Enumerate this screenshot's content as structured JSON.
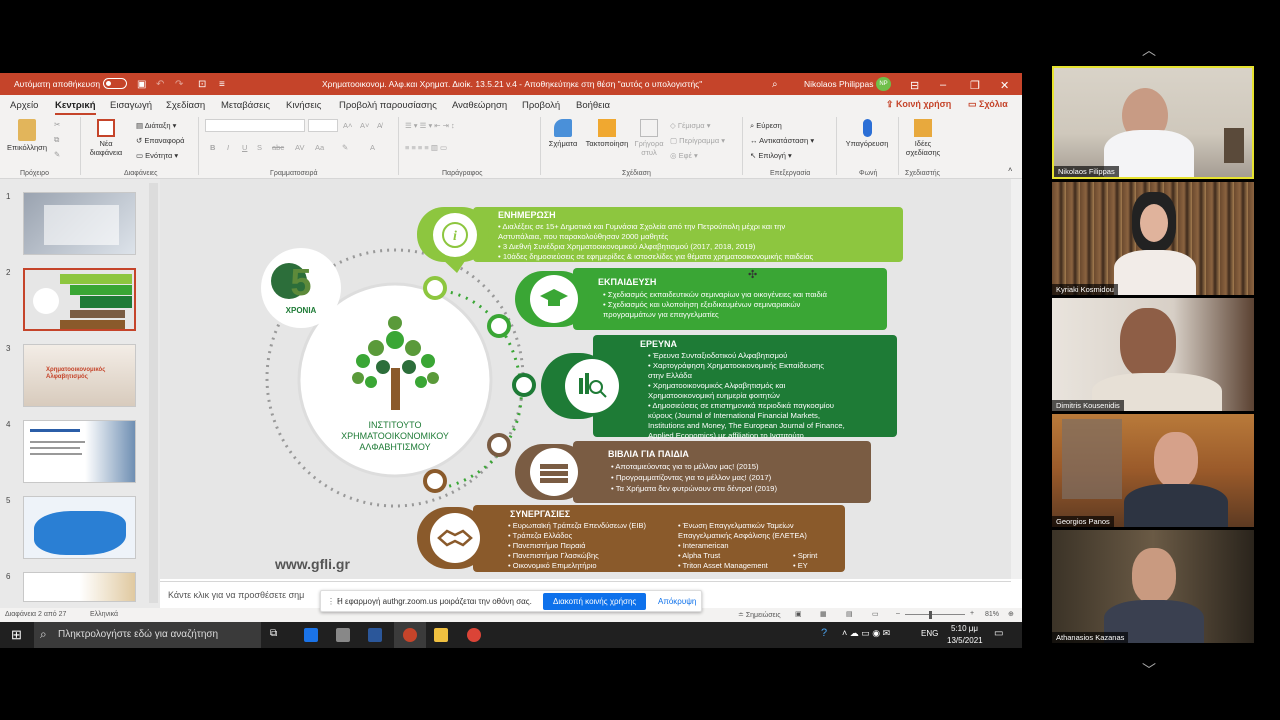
{
  "titlebar": {
    "autosave": "Αυτόματη αποθήκευση",
    "doc_title": "Χρηματοοικονομ. Αλφ.και Χρηματ. Διοίκ. 13.5.21 v.4  -  Αποθηκεύτηκε στη θέση \"αυτός ο υπολογιστής\"",
    "user": "Nikolaos Philippas",
    "user_initials": "NP"
  },
  "menu": {
    "tabs": [
      "Αρχείο",
      "Κεντρική",
      "Εισαγωγή",
      "Σχεδίαση",
      "Μεταβάσεις",
      "Κινήσεις",
      "Προβολή παρουσίασης",
      "Αναθεώρηση",
      "Προβολή",
      "Βοήθεια"
    ],
    "share": "Κοινή χρήση",
    "comments": "Σχόλια"
  },
  "ribbon": {
    "paste": "Επικόλληση",
    "new_slide_1": "Νέα",
    "new_slide_2": "διαφάνεια",
    "layout": "Διάταξη",
    "reset": "Επαναφορά",
    "section": "Ενότητα",
    "shapes": "Σχήματα",
    "arrange": "Τακτοποίηση",
    "quick_styles_1": "Γρήγορα",
    "quick_styles_2": "στυλ",
    "fill": "Γέμισμα",
    "outline": "Περίγραμμα",
    "effects": "Εφέ",
    "find": "Εύρεση",
    "replace": "Αντικατάσταση",
    "select": "Επιλογή",
    "dictate": "Υπαγόρευση",
    "ideas_1": "Ιδέες",
    "ideas_2": "σχεδίασης",
    "groups": [
      "Πρόχειρο",
      "Διαφάνειες",
      "Γραμματοσειρά",
      "Παράγραφος",
      "Σχέδιαση",
      "Επεξεργασία",
      "Φωνή",
      "Σχεδιαστής"
    ]
  },
  "thumbnails": {
    "numbers": [
      "1",
      "2",
      "3",
      "4",
      "5",
      "6"
    ],
    "slide3_title": "Χρηματοοικονομικός Αλφαβητισμός"
  },
  "slide": {
    "logo_years": "5",
    "logo_word": "ΧΡΟΝΙΑ",
    "institute": [
      "ΙΝΣΤΙΤΟΥΤΟ",
      "ΧΡΗΜΑΤΟΟΙΚΟΝΟΜΙΚΟΥ",
      "ΑΛΦΑΒΗΤΙΣΜΟΥ"
    ],
    "website": "www.gfli.gr",
    "sections": [
      {
        "title": "ΕΝΗΜΕΡΩΣΗ",
        "lines": [
          "• Διαλέξεις σε 15+ Δημοτικά και Γυμνάσια Σχολεία από την Πετρούπολη μέχρι και την",
          "   Αστυπάλαια, που παρακολούθησαν 2000 μαθητές",
          "• 3 Διεθνή Συνέδρια Χρηματοοικονομικού Αλφαβητισμού (2017, 2018, 2019)",
          "• 10άδες δημοσιεύσεις σε εφημερίδες & ιστοσελίδες για θέματα χρηματοοικονομικής παιδείας"
        ],
        "color": "#8dc63f"
      },
      {
        "title": "ΕΚΠΑΙΔΕΥΣΗ",
        "lines": [
          "• Σχεδιασμός εκπαιδευτικών σεμιναρίων για οικογένειες και παιδιά",
          "• Σχεδιασμός και υλοποίηση εξειδικευμένων σεμιναριακών",
          "   προγραμμάτων για επαγγελματίες"
        ],
        "color": "#3aa635"
      },
      {
        "title": "ΕΡΕΥΝΑ",
        "lines": [
          "• Έρευνα Συνταξιοδοτικού Αλφαβητισμού",
          "• Χαρτογράφηση Χρηματοοικονομικής Εκπαίδευσης",
          "   στην Ελλάδα",
          "• Χρηματοοικονομικός Αλφαβητισμός και",
          "   Χρηματοοικονομική ευημερία φοιτητών",
          "• Δημοσιεύσεις σε επιστημονικά περιοδικά παγκοσμίου",
          "   κύρους (Journal of International Financial Markets,",
          "   Institutions and Money, The European Journal of Finance,",
          "   Applied Economics) με affiliation το Ινστιτούτο"
        ],
        "color": "#1e7b36"
      },
      {
        "title": "ΒΙΒΛΙΑ ΓΙΑ ΠΑΙΔΙΑ",
        "lines": [
          "• Αποταμιεύοντας για το μέλλον μας! (2015)",
          "• Προγραμματίζοντας για το μέλλον μας! (2017)",
          "• Τα Χρήματα δεν φυτρώνουν στα δέντρα! (2019)"
        ],
        "color": "#7a5c43"
      },
      {
        "title": "ΣΥΝΕΡΓΑΣΙΕΣ",
        "lines": [
          "• Ευρωπαϊκή Τράπεζα Επενδύσεων (ΕΙΒ)",
          "• Τράπεζα Ελλάδος",
          "• Πανεπιστήμιο Πειραιά",
          "• Πανεπιστήμιο Γλασκώβης",
          "• Οικονομικό Επιμελητήριο"
        ],
        "lines2": [
          "• Ένωση Επαγγελματικών Ταμείων",
          "   Επαγγελματικής Ασφάλισης (ΕΛΕΤΕΑ)",
          "• Interamerican",
          "• Alpha Trust",
          "• Triton Asset Management"
        ],
        "lines3": [
          "• Sprint",
          "• EY"
        ],
        "color": "#8a5a2b"
      }
    ]
  },
  "notes_placeholder": "Κάντε κλικ για να προσθέσετε σημ",
  "statusbar": {
    "slide_count": "Διαφάνεια 2 από 27",
    "language": "Ελληνικά",
    "notes": "Σημειώσεις",
    "zoom": "81%"
  },
  "share_banner": {
    "text": "Η εφαρμογή authgr.zoom.us μοιράζεται την οθόνη σας.",
    "stop_button": "Διακοπή κοινής χρήσης",
    "hide_button": "Απόκρυψη"
  },
  "taskbar": {
    "search_placeholder": "Πληκτρολογήστε εδώ για αναζήτηση",
    "lang": "ENG",
    "time": "5:10 μμ",
    "date": "13/5/2021"
  },
  "participants": [
    "Nikolaos Filippas",
    "Kyriaki Kosmidou",
    "Dimitris Kousenidis",
    "Georgios Panos",
    "Athanasios Kazanas"
  ],
  "colors": {
    "accent": "#c5442a",
    "zoom_blue": "#0e71eb",
    "active_speaker": "#e7e32f"
  }
}
